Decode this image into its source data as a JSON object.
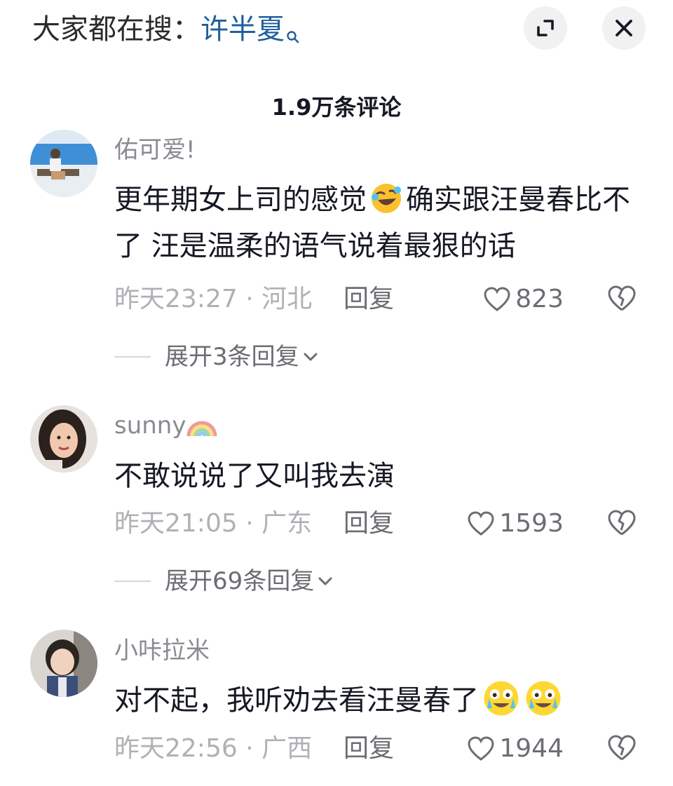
{
  "header": {
    "search_prefix": "大家都在搜：",
    "search_term": "许半夏",
    "expand_icon": "expand-icon",
    "close_icon": "close-icon"
  },
  "comment_count": "1.9万条评论",
  "comments": [
    {
      "username": "佑可爱!",
      "text_before_emoji": "更年期女上司的感觉",
      "emoji": "rolling-laughing-emoji",
      "text_after_emoji": "确实跟汪曼春比不了 汪是温柔的语气说着最狠的话",
      "meta": "昨天23:27 · 河北",
      "reply_label": "回复",
      "likes": "823",
      "expand_label": "展开3条回复"
    },
    {
      "username": "sunny",
      "username_emoji": "rainbow-emoji",
      "text": "不敢说说了又叫我去演",
      "meta": "昨天21:05 · 广东",
      "reply_label": "回复",
      "likes": "1593",
      "expand_label": "展开69条回复"
    },
    {
      "username": "小咔拉米",
      "text": "对不起，我听劝去看汪曼春了",
      "emoji": "crying-laughing-emoji",
      "meta": "昨天22:56 · 广西",
      "reply_label": "回复",
      "likes": "1944"
    }
  ],
  "colors": {
    "search_term": "#1f5f9e",
    "username": "#8a8b91",
    "meta": "#b0b1b5",
    "action": "#6c6d73"
  }
}
